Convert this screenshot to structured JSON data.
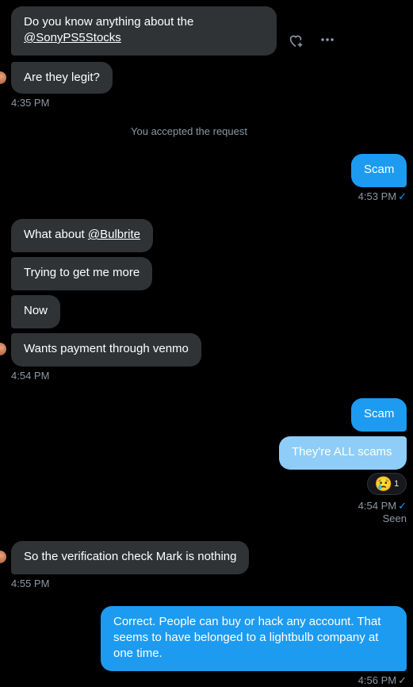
{
  "messages": {
    "m1_text": "Do you know anything about the",
    "m1_mention": "@SonyPS5Stocks",
    "m2_text": "Are they legit?",
    "t1": "4:35 PM",
    "system_text": "You accepted the request",
    "m3_text": "Scam",
    "t2": "4:53 PM",
    "m4_text": "What about ",
    "m4_mention": "@Bulbrite",
    "m5_text": "Trying to get me more",
    "m6_text": "Now",
    "m7_text": "Wants payment through venmo",
    "t3": "4:54 PM",
    "m8_text": "Scam",
    "m9_text": "They're ALL scams",
    "reaction_emoji": "😢",
    "reaction_count": "1",
    "t4": "4:54 PM",
    "seen": "Seen",
    "m10_text": "So the verification check Mark is nothing",
    "t5": "4:55 PM",
    "m11_text": "Correct. People can buy or hack any account. That seems to have belonged to a lightbulb company at one time.",
    "t6": "4:56 PM"
  },
  "icons": {
    "react": "heart-add-icon",
    "more": "more-horizontal-icon",
    "check_blue": "✓",
    "check_grey": "✓"
  },
  "colors": {
    "background": "#000000",
    "incoming_bubble": "#2f3336",
    "outgoing_bubble": "#1d9bf0",
    "outgoing_bubble_light": "#8ecdf7",
    "meta_text": "#8b98a5"
  }
}
